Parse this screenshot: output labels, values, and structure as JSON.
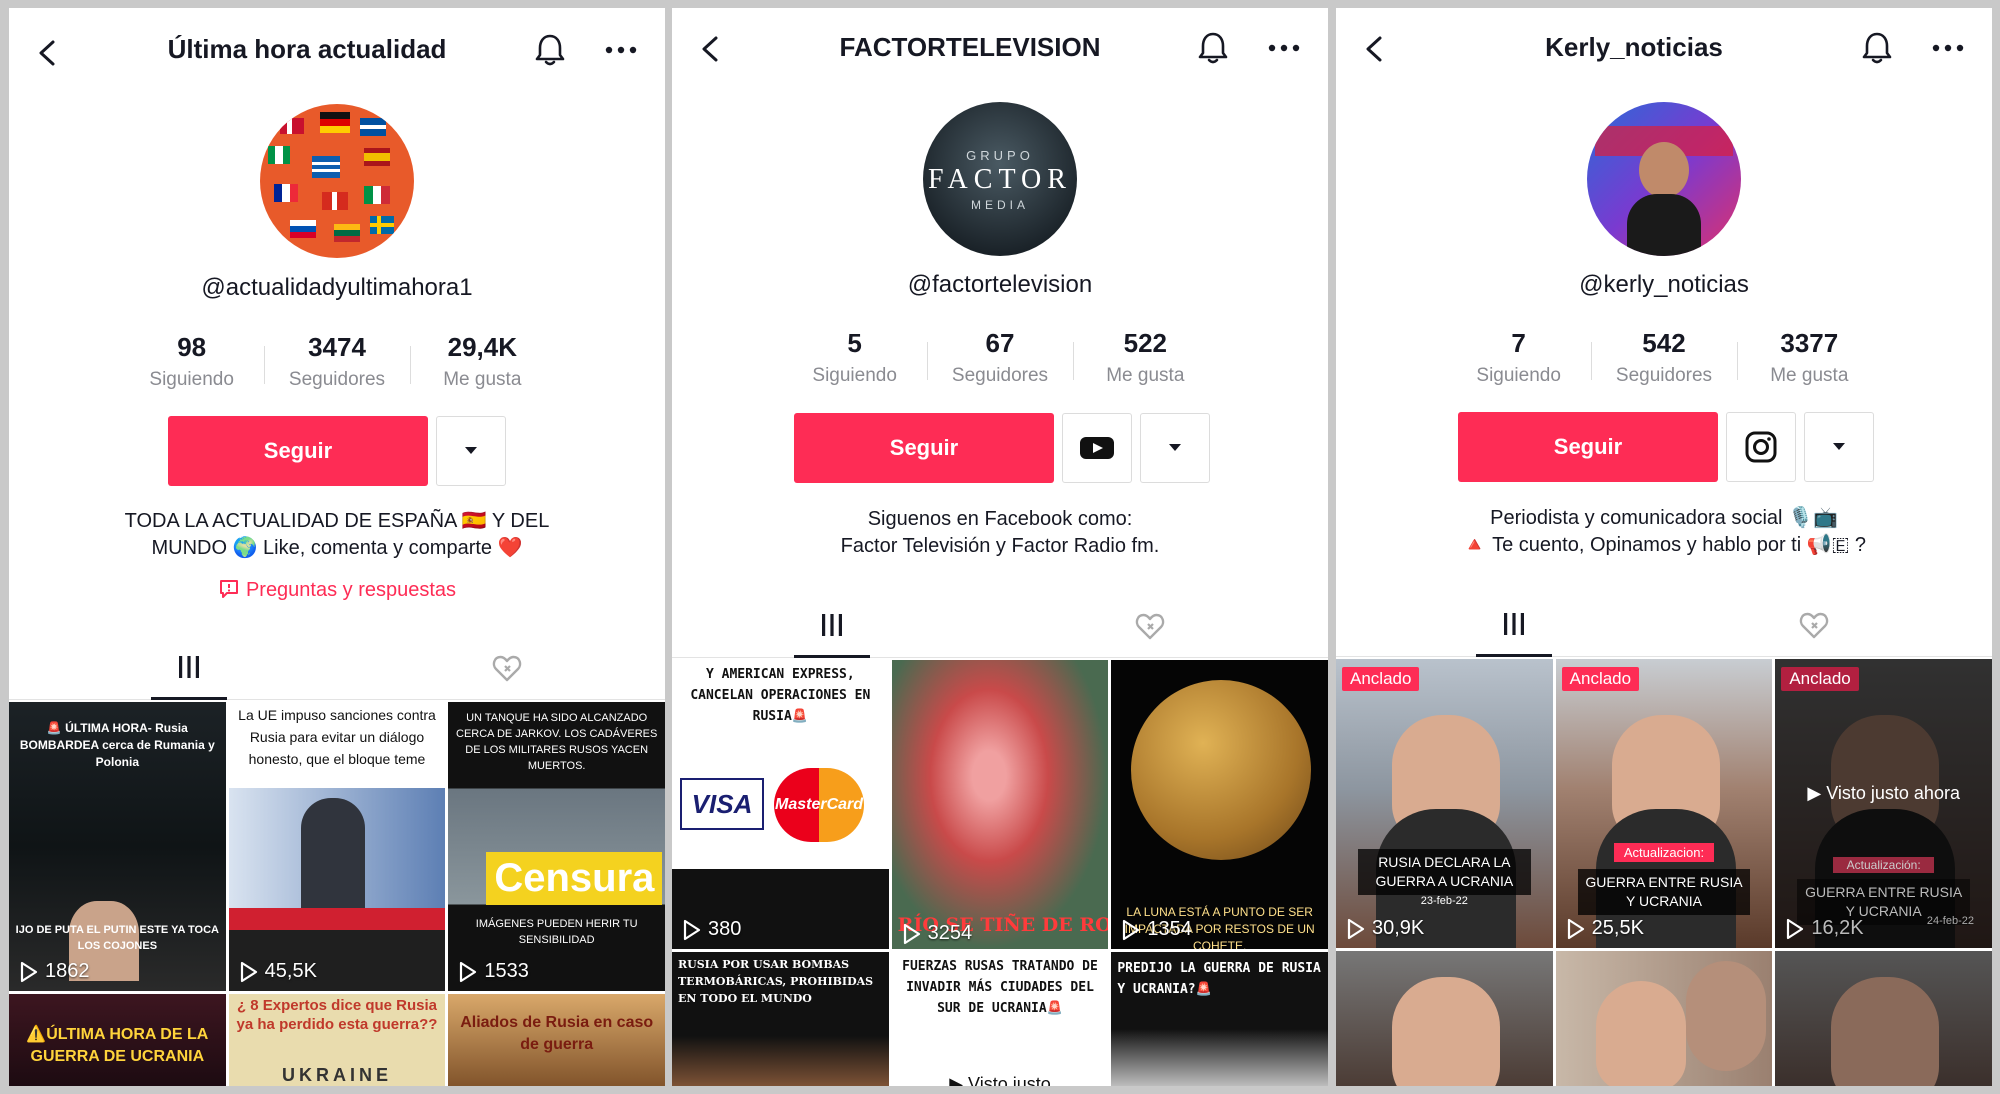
{
  "profiles": [
    {
      "title": "Última hora actualidad",
      "username": "@actualidadyultimahora1",
      "stats": [
        {
          "num": "98",
          "label": "Siguiendo"
        },
        {
          "num": "3474",
          "label": "Seguidores"
        },
        {
          "num": "29,4K",
          "label": "Me gusta"
        }
      ],
      "follow_label": "Seguir",
      "bio_line1": "TODA LA ACTUALIDAD DE ESPAÑA 🇪🇸 Y DEL",
      "bio_line2": "MUNDO 🌍 Like, comenta y comparte ❤️",
      "qa_label": "Preguntas y respuestas",
      "videos": [
        {
          "views": "1862",
          "text_top": "🚨 ÚLTIMA HORA- Rusia BOMBARDEA cerca de Rumania y Polonia",
          "text_bottom": "IJO DE PUTA EL PUTIN ESTE YA TOCA LOS COJONES"
        },
        {
          "views": "45,5K",
          "text_top": "La UE impuso sanciones contra Rusia para evitar un diálogo honesto, que el bloque teme"
        },
        {
          "views": "1533",
          "text_top": "UN TANQUE HA SIDO ALCANZADO CERCA DE JARKOV. LOS CADÁVERES DE LOS MILITARES RUSOS YACEN MUERTOS.",
          "stamp": "Censura",
          "text_bottom": "IMÁGENES PUEDEN HERIR TU SENSIBILIDAD"
        },
        {
          "views": "",
          "text_top": "⚠️ÚLTIMA HORA DE LA GUERRA DE UCRANIA"
        },
        {
          "views": "",
          "text_top": "¿ 8 Expertos dice que Rusia ya ha perdido esta guerra??",
          "text_bottom": "UKRAINE"
        },
        {
          "views": "",
          "text_top": "Aliados de Rusia en caso de guerra"
        }
      ]
    },
    {
      "title": "FACTORTELEVISION",
      "username": "@factortelevision",
      "avatar_line1": "GRUPO",
      "avatar_line2": "FACTOR",
      "avatar_line3": "MEDIA",
      "stats": [
        {
          "num": "5",
          "label": "Siguiendo"
        },
        {
          "num": "67",
          "label": "Seguidores"
        },
        {
          "num": "522",
          "label": "Me gusta"
        }
      ],
      "follow_label": "Seguir",
      "bio_line1": "Siguenos en Facebook como:",
      "bio_line2": "Factor Televisión y Factor Radio fm.",
      "videos": [
        {
          "views": "380",
          "text_top": "Y AMERICAN EXPRESS, CANCELAN OPERACIONES EN RUSIA🚨",
          "visa": "VISA",
          "mc": "MasterCard"
        },
        {
          "views": "3254",
          "text_bottom": "RÍO SE TIÑE DE ROJO EN PL"
        },
        {
          "views": "1354",
          "text_bottom": "LA LUNA ESTÁ A PUNTO DE SER IMPACTADA POR RESTOS DE UN COHETE."
        },
        {
          "views": "",
          "text_top": "RUSIA POR USAR BOMBAS TERMOBÁRICAS, PROHIBIDAS EN TODO EL MUNDO"
        },
        {
          "views": "",
          "text_top": "FUERZAS RUSAS TRATANDO DE INVADIR MÁS CIUDADES DEL SUR DE UCRANIA🚨",
          "seen": "▶ Visto justo"
        },
        {
          "views": "",
          "text_top": "PREDIJO LA GUERRA DE RUSIA Y UCRANIA?🚨"
        }
      ]
    },
    {
      "title": "Kerly_noticias",
      "username": "@kerly_noticias",
      "stats": [
        {
          "num": "7",
          "label": "Siguiendo"
        },
        {
          "num": "542",
          "label": "Seguidores"
        },
        {
          "num": "3377",
          "label": "Me gusta"
        }
      ],
      "follow_label": "Seguir",
      "bio_line1": "Periodista y comunicadora social 🎙️📺",
      "bio_line2": "🔺 Te cuento, Opinamos y hablo por ti 📢🇪 ?",
      "videos": [
        {
          "views": "30,9K",
          "badge": "Anclado",
          "caption": "RUSIA DECLARA LA GUERRA A UCRANIA",
          "date": "23-feb-22"
        },
        {
          "views": "25,5K",
          "badge": "Anclado",
          "caption_top": "Actualizacion:",
          "caption": "GUERRA ENTRE RUSIA Y UCRANIA"
        },
        {
          "views": "16,2K",
          "badge": "Anclado",
          "seen": "▶ Visto justo ahora",
          "caption_top": "Actualización:",
          "caption": "GUERRA ENTRE RUSIA Y UCRANIA",
          "date": "24-feb-22"
        },
        {
          "views": ""
        },
        {
          "views": ""
        },
        {
          "views": ""
        }
      ]
    }
  ],
  "colors": {
    "accent": "#fe2c55",
    "text": "#161823",
    "muted": "#8a8b91"
  },
  "icons": [
    "back-icon",
    "bell-icon",
    "more-icon",
    "caret-down-icon",
    "youtube-icon",
    "instagram-icon",
    "grid-icon",
    "liked-videos-icon",
    "play-icon",
    "question-icon"
  ]
}
